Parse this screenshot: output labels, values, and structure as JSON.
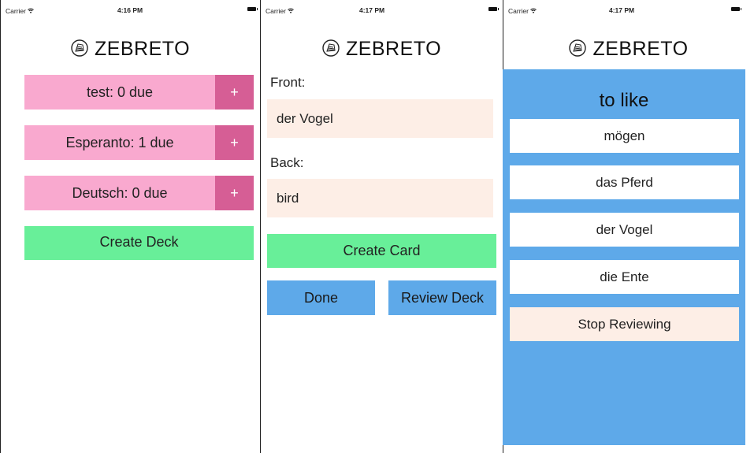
{
  "screens": [
    {
      "status": {
        "carrier": "Carrier",
        "time": "4:16 PM"
      }
    },
    {
      "status": {
        "carrier": "Carrier",
        "time": "4:17 PM"
      }
    },
    {
      "status": {
        "carrier": "Carrier",
        "time": "4:17 PM"
      }
    }
  ],
  "app_title": "ZEBRETO",
  "decks_screen": {
    "decks": [
      {
        "label": "test: 0 due",
        "add_label": "+"
      },
      {
        "label": "Esperanto: 1 due",
        "add_label": "+"
      },
      {
        "label": "Deutsch: 0 due",
        "add_label": "+"
      }
    ],
    "create_deck_label": "Create Deck"
  },
  "card_screen": {
    "front_label": "Front:",
    "front_value": "der Vogel",
    "back_label": "Back:",
    "back_value": "bird",
    "create_card_label": "Create Card",
    "done_label": "Done",
    "review_deck_label": "Review Deck"
  },
  "review_screen": {
    "prompt": "to like",
    "choices": [
      "mögen",
      "das Pferd",
      "der Vogel",
      "die Ente"
    ],
    "stop_label": "Stop Reviewing"
  },
  "colors": {
    "deck_pink": "#f9a9cf",
    "deck_add_pink": "#d65e95",
    "green": "#68ef99",
    "blue": "#5ea9e9",
    "input_bg": "#fdeee6"
  },
  "icons": {
    "logo": "zebra-logo-icon",
    "wifi": "wifi-icon",
    "battery": "battery-icon"
  }
}
